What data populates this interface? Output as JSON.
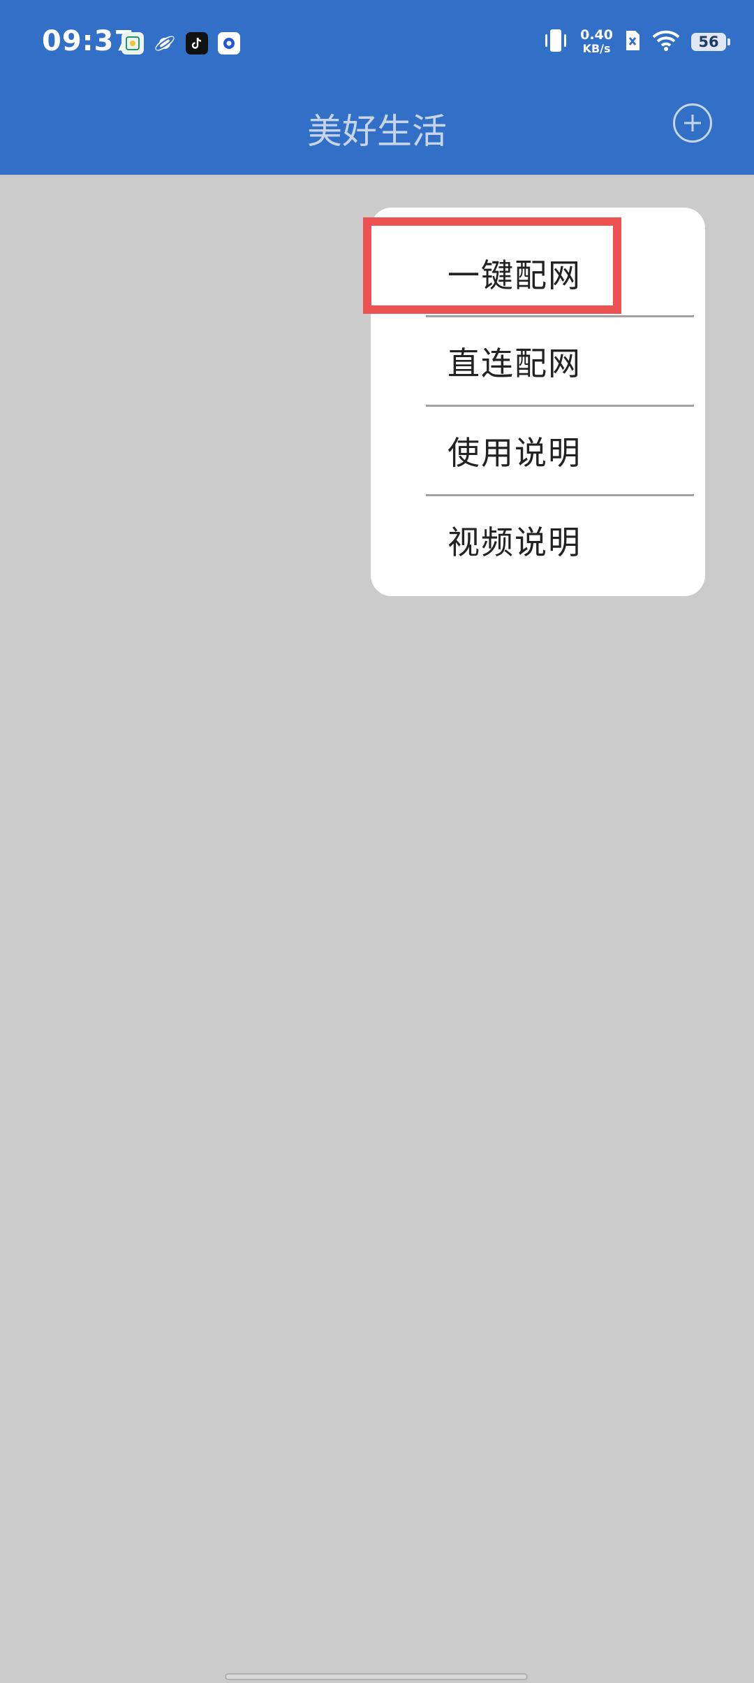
{
  "status_bar": {
    "time": "09:37",
    "net_speed_value": "0.40",
    "net_speed_unit": "KB/s",
    "battery_level": "56",
    "notification_icons": [
      "photo-app-icon",
      "planet-app-icon",
      "tiktok-icon",
      "camera-app-icon"
    ]
  },
  "header": {
    "title": "美好生活",
    "add_icon": "plus-circle-icon"
  },
  "menu": {
    "items": [
      {
        "label": "一键配网"
      },
      {
        "label": "直连配网"
      },
      {
        "label": "使用说明"
      },
      {
        "label": "视频说明"
      }
    ]
  },
  "colors": {
    "app_bar": "#3170c6",
    "background": "#cbcbcb",
    "highlight": "#ec5251"
  }
}
